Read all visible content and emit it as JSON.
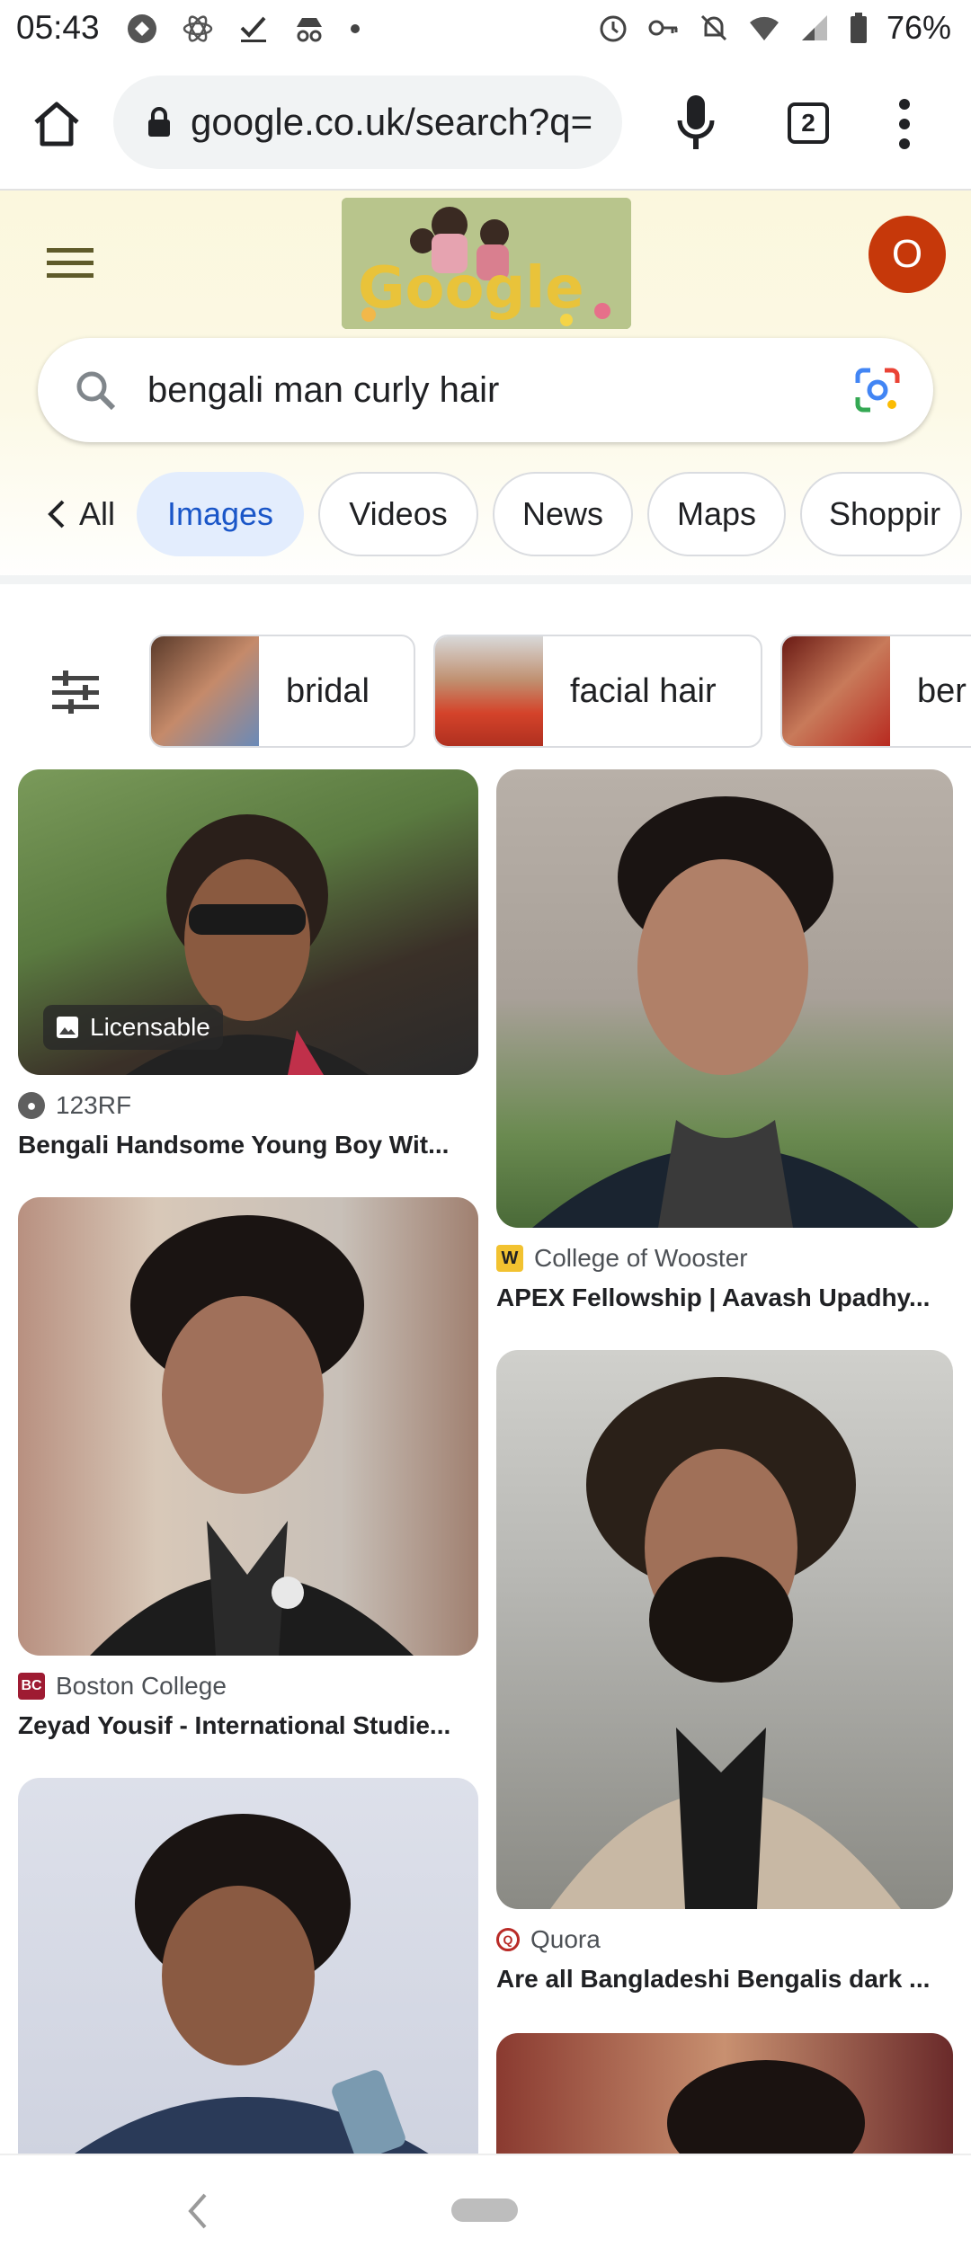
{
  "status_bar": {
    "time": "05:43",
    "battery": "76%",
    "left_icons": [
      "opera-icon",
      "atom-icon",
      "check-icon",
      "incognito-icon",
      "dot-icon"
    ],
    "right_icons": [
      "alarm-icon",
      "key-icon",
      "mute-icon",
      "wifi-icon",
      "signal-icon",
      "battery-icon"
    ]
  },
  "browser": {
    "url": "google.co.uk/search?q=",
    "tab_count": "2"
  },
  "google": {
    "avatar_letter": "O",
    "search_query": "bengali man curly hair"
  },
  "tabs": [
    {
      "label": "All",
      "active": false
    },
    {
      "label": "Images",
      "active": true
    },
    {
      "label": "Videos",
      "active": false
    },
    {
      "label": "News",
      "active": false
    },
    {
      "label": "Maps",
      "active": false
    },
    {
      "label": "Shoppir",
      "active": false
    }
  ],
  "chips": [
    {
      "label": "bridal"
    },
    {
      "label": "facial hair"
    },
    {
      "label": "ber"
    }
  ],
  "results": {
    "left": [
      {
        "source": "123RF",
        "title": "Bengali Handsome Young Boy Wit...",
        "badge": "Licensable"
      },
      {
        "source": "Boston College",
        "title": "Zeyad Yousif - International Studie..."
      },
      {
        "source": "",
        "title": ""
      }
    ],
    "right": [
      {
        "source": "College of Wooster",
        "title": "APEX Fellowship | Aavash Upadhy..."
      },
      {
        "source": "Quora",
        "title": "Are all Bangladeshi Bengalis dark ..."
      },
      {
        "source": "",
        "title": ""
      }
    ]
  },
  "colors": {
    "active_tab_bg": "#e3edfd",
    "active_tab_text": "#1a56c8",
    "avatar": "#c6380a",
    "header_bg": "#fbf7dd"
  }
}
